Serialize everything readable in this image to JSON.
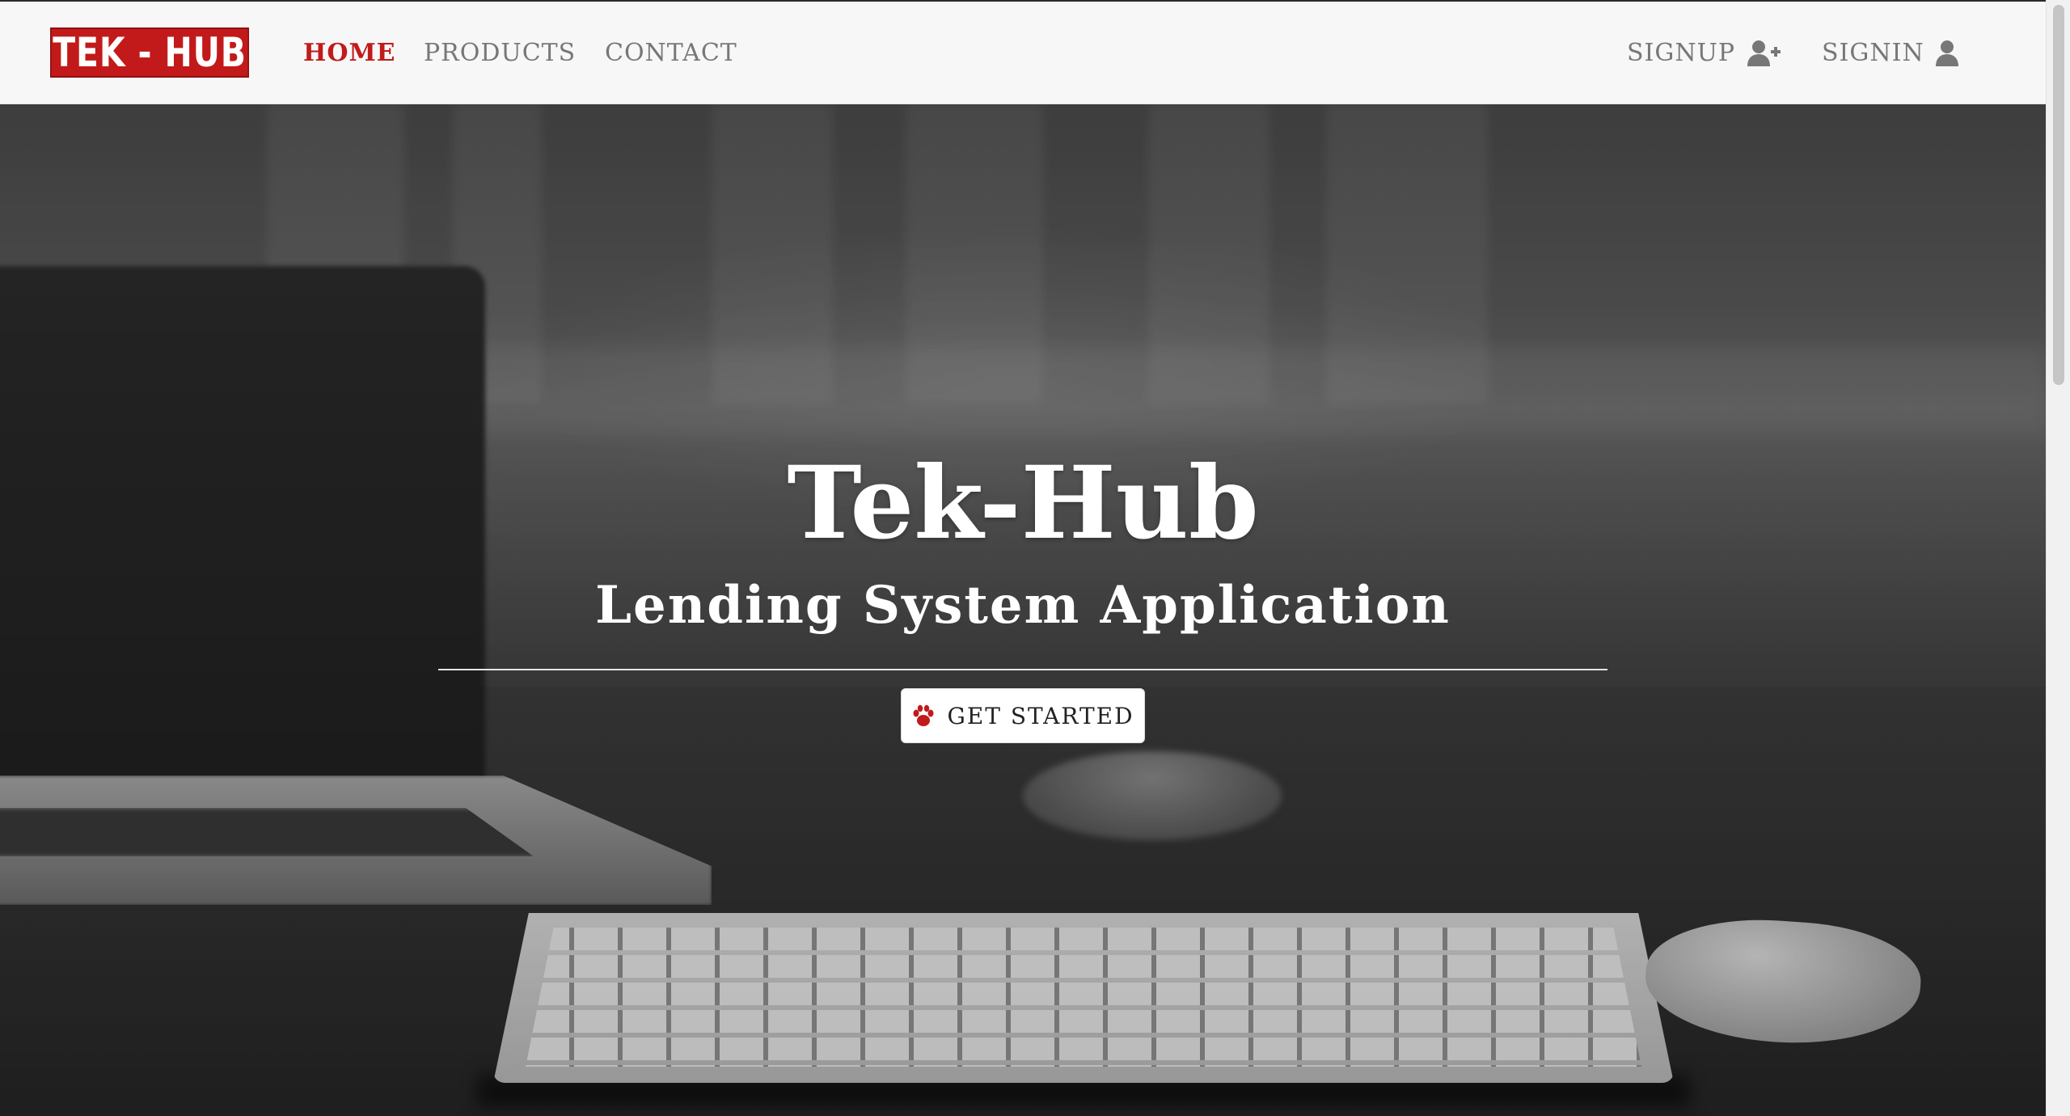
{
  "brand": {
    "logo_text": "TEK - HUB",
    "color": "#c21a1a"
  },
  "nav": {
    "links": [
      {
        "label": "HOME",
        "active": true
      },
      {
        "label": "PRODUCTS",
        "active": false
      },
      {
        "label": "CONTACT",
        "active": false
      }
    ],
    "signup_label": "SIGNUP",
    "signup_icon": "user-plus-icon",
    "signin_label": "SIGNIN",
    "signin_icon": "user-icon"
  },
  "hero": {
    "title": "Tek-Hub",
    "subtitle": "Lending System Application",
    "cta_label": "GET STARTED",
    "cta_icon": "paw-icon",
    "background": "grayscale desk with keyboard, mouse and laptop"
  },
  "colors": {
    "accent": "#c21a1a",
    "nav_bg": "#f7f7f8",
    "nav_text": "#777777"
  }
}
